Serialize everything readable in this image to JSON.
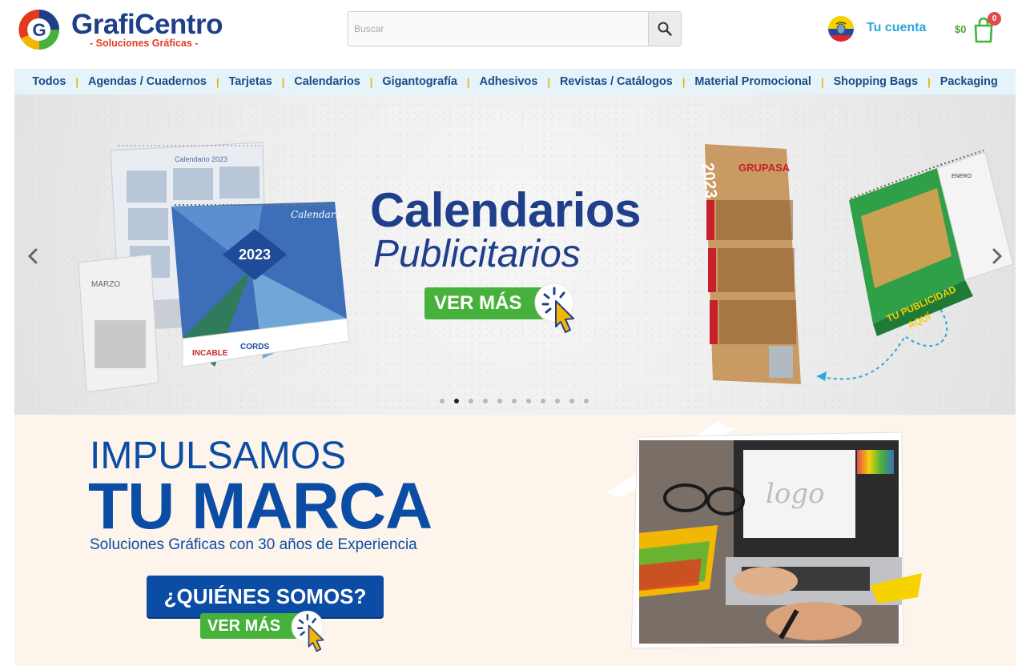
{
  "header": {
    "logo": {
      "title": "GrafiCentro",
      "subtitle": "- Soluciones Gráficas -"
    },
    "search": {
      "placeholder": "Buscar",
      "value": ""
    },
    "account_label": "Tu cuenta",
    "cart": {
      "total": "$0",
      "count": "0"
    }
  },
  "nav": {
    "items": [
      {
        "label": "Todos"
      },
      {
        "label": "Agendas / Cuadernos"
      },
      {
        "label": "Tarjetas"
      },
      {
        "label": "Calendarios"
      },
      {
        "label": "Gigantografía"
      },
      {
        "label": "Adhesivos"
      },
      {
        "label": "Revistas / Catálogos"
      },
      {
        "label": "Material Promocional"
      },
      {
        "label": "Shopping Bags"
      },
      {
        "label": "Packaging"
      }
    ]
  },
  "slider": {
    "title_line1": "Calendarios",
    "title_line2": "Publicitarios",
    "cta": "VER MÁS",
    "slide_count": 11,
    "active_slide": 2,
    "left_calendar": {
      "header": "Calendario 2023",
      "year": "2023",
      "label": "Calendario",
      "month": "MARZO",
      "brand1": "INCABLE",
      "brand2": "CORDS"
    },
    "right_calendar": {
      "year": "2023",
      "brand": "GRUPASA",
      "tagline_1": "TU PUBLICIDAD",
      "tagline_2": "AQUÍ",
      "month": "ENERO"
    }
  },
  "brand": {
    "line1": "IMPULSAMOS",
    "line2": "TU MARCA",
    "line3": "Soluciones Gráficas con 30 años de Experiencia",
    "who_button": "¿QUIÉNES SOMOS?",
    "more_button": "VER MÁS",
    "screen_logo_text": "logo"
  },
  "colors": {
    "brand_blue": "#1f3f8a",
    "nav_blue": "#1b4a88",
    "account_cyan": "#29a7d9",
    "accent_green": "#47b23b",
    "nav_bg": "#e4f4fa",
    "section_bg": "#fdf5ec"
  },
  "icons": [
    "logo-g-icon",
    "search-icon",
    "ecuador-flag-icon",
    "shopping-bag-icon",
    "chevron-left-icon",
    "chevron-right-icon",
    "pointer-cursor-icon"
  ]
}
